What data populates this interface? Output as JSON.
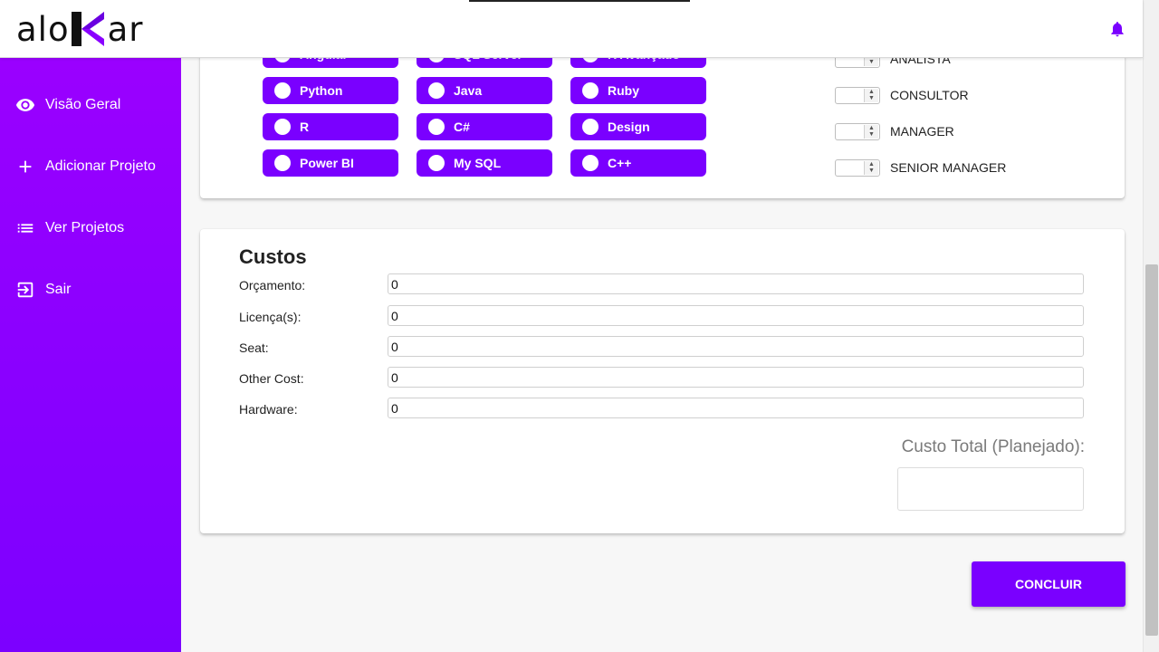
{
  "app": {
    "logo_prefix": "alo",
    "logo_suffix": "ar",
    "logo_k": "k"
  },
  "sidebar": {
    "items": [
      {
        "label": "Visão Geral",
        "icon": "eye-icon"
      },
      {
        "label": "Adicionar Projeto",
        "icon": "plus-icon"
      },
      {
        "label": "Ver Projetos",
        "icon": "list-icon"
      },
      {
        "label": "Sair",
        "icon": "logout-icon"
      }
    ]
  },
  "skills": {
    "rows": [
      [
        "Angular",
        "SQL Server",
        "R Avançado"
      ],
      [
        "Python",
        "Java",
        "Ruby"
      ],
      [
        "R",
        "C#",
        "Design"
      ],
      [
        "Power BI",
        "My SQL",
        "C++"
      ]
    ]
  },
  "roles": {
    "items": [
      "ANALISTA",
      "CONSULTOR",
      "MANAGER",
      "SENIOR MANAGER"
    ]
  },
  "costs": {
    "title": "Custos",
    "fields": [
      {
        "label": "Orçamento:",
        "value": "0"
      },
      {
        "label": "Licença(s):",
        "value": "0"
      },
      {
        "label": "Seat:",
        "value": "0"
      },
      {
        "label": "Other Cost:",
        "value": "0"
      },
      {
        "label": "Hardware:",
        "value": "0"
      }
    ],
    "total_label": "Custo Total (Planejado):",
    "total_value": ""
  },
  "actions": {
    "submit_label": "CONCLUIR"
  },
  "colors": {
    "accent": "#7a00ff",
    "sidebar_top": "#9a00ff",
    "sidebar_bottom": "#7c00ff"
  }
}
